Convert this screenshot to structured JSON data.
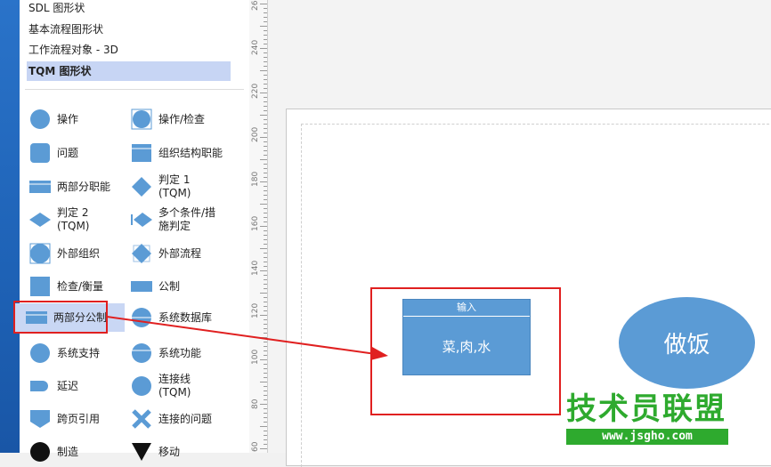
{
  "stencils": [
    {
      "label": "SDL 图形状"
    },
    {
      "label": "基本流程图形状"
    },
    {
      "label": "工作流程对象 - 3D"
    },
    {
      "label": "TQM 图形状"
    }
  ],
  "shapes": [
    {
      "label": "操作",
      "icon": "circle"
    },
    {
      "label": "操作/检查",
      "icon": "circle-square"
    },
    {
      "label": "问题",
      "icon": "rounded-square"
    },
    {
      "label": "组织结构职能",
      "icon": "header-rect"
    },
    {
      "label": "两部分职能",
      "icon": "two-part-rect"
    },
    {
      "label": "判定 1\n(TQM)",
      "icon": "diamond"
    },
    {
      "label": "判定 2\n(TQM)",
      "icon": "diamond-wide"
    },
    {
      "label": "多个条件/措\n施判定",
      "icon": "diamond-multi"
    },
    {
      "label": "外部组织",
      "icon": "circle-square"
    },
    {
      "label": "外部流程",
      "icon": "diamond-square"
    },
    {
      "label": "检查/衡量",
      "icon": "square"
    },
    {
      "label": "公制",
      "icon": "wide-rect"
    },
    {
      "label": "两部分公制",
      "icon": "two-part-rect"
    },
    {
      "label": "系统数据库",
      "icon": "circle-lined"
    },
    {
      "label": "系统支持",
      "icon": "circle"
    },
    {
      "label": "系统功能",
      "icon": "circle-lined"
    },
    {
      "label": "延迟",
      "icon": "delay"
    },
    {
      "label": "连接线\n(TQM)",
      "icon": "circle"
    },
    {
      "label": "跨页引用",
      "icon": "offpage"
    },
    {
      "label": "连接的问题",
      "icon": "x"
    },
    {
      "label": "制造",
      "icon": "circle-dark"
    },
    {
      "label": "移动",
      "icon": "triangle-dark"
    }
  ],
  "ruler": [
    "260",
    "240",
    "220",
    "200",
    "180",
    "160",
    "140",
    "120",
    "100",
    "80",
    "60"
  ],
  "canvas": {
    "input_shape": {
      "title": "输入",
      "body": "菜,肉,水"
    },
    "oval": {
      "text": "做饭"
    }
  },
  "watermark": {
    "title": "技术员联盟",
    "url": "www.jsgho.com"
  },
  "colors": {
    "shape_fill": "#5b9bd5",
    "highlight": "#e02020",
    "watermark": "#2eaa2e"
  }
}
